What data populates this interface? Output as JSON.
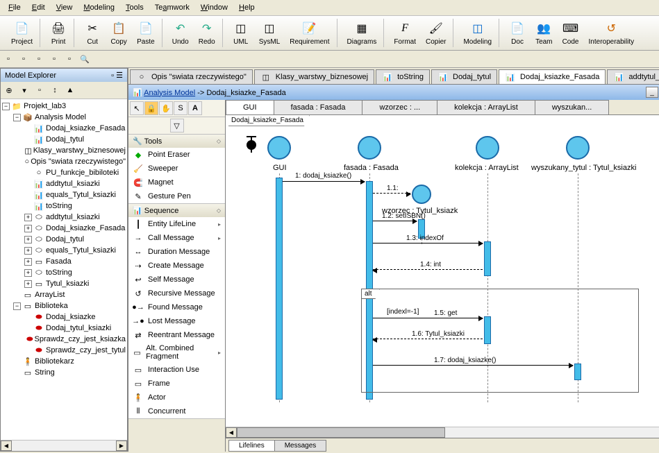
{
  "menu": {
    "file": "File",
    "edit": "Edit",
    "view": "View",
    "modeling": "Modeling",
    "tools": "Tools",
    "teamwork": "Teamwork",
    "window": "Window",
    "help": "Help"
  },
  "toolbar": {
    "project": "Project",
    "print": "Print",
    "cut": "Cut",
    "copy": "Copy",
    "paste": "Paste",
    "undo": "Undo",
    "redo": "Redo",
    "uml": "UML",
    "sysml": "SysML",
    "requirement": "Requirement",
    "diagrams": "Diagrams",
    "format": "Format",
    "copier": "Copier",
    "modeling": "Modeling",
    "doc": "Doc",
    "team": "Team",
    "code": "Code",
    "interoperability": "Interoperability"
  },
  "explorer": {
    "title": "Model Explorer",
    "root": "Projekt_lab3",
    "items": [
      "Analysis Model",
      "Dodaj_ksiazke_Fasada",
      "Dodaj_tytul",
      "Klasy_warstwy_biznesowej",
      "Opis \"swiata rzeczywistego\"",
      "PU_funkcje_bibiloteki",
      "addtytul_ksiazki",
      "equals_Tytul_ksiazki",
      "toString",
      "addtytul_ksiazki",
      "Dodaj_ksiazke_Fasada",
      "Dodaj_tytul",
      "equals_Tytul_ksiazki",
      "Fasada",
      "toString",
      "Tytul_ksiazki",
      "ArrayList",
      "Biblioteka",
      "Dodaj_ksiazke",
      "Dodaj_tytul_ksiazki",
      "Sprawdz_czy_jest_ksiazka",
      "Sprawdz_czy_jest_tytul",
      "Bibliotekarz",
      "String"
    ]
  },
  "doc_tabs": [
    "Opis \"swiata rzeczywistego\"",
    "Klasy_warstwy_biznesowej",
    "toString",
    "Dodaj_tytul",
    "Dodaj_ksiazke_Fasada",
    "addtytul_ksiazki"
  ],
  "diagram": {
    "breadcrumb_model": "Analysis Model",
    "breadcrumb_diag": "Dodaj_ksiazke_Fasada",
    "lifelines": [
      "GUI",
      "fasada : Fasada",
      "wzorzec : ...",
      "kolekcja : ArrayList",
      "wyszukan..."
    ],
    "frame_label": "Dodaj_ksiazke_Fasada",
    "actors": {
      "gui": "GUI",
      "fasada": "fasada : Fasada",
      "wzorzec": "wzorzec : Tytul_ksiazk",
      "kolekcja": "kolekcja : ArrayList",
      "wyszukany": "wyszukany_tytul : Tytul_ksiazki"
    },
    "messages": {
      "m1": "1: dodaj_ksiazke()",
      "m11": "1.1:",
      "m12": "1.2: setISBN()",
      "m13": "1.3: indexOf",
      "m14": "1.4: int",
      "m15": "1.5: get",
      "m16": "1.6: Tytul_ksiazki",
      "m17": "1.7: dodaj_ksiazke()"
    },
    "alt": "alt",
    "guard": "[indexl=-1]"
  },
  "palette": {
    "tools_title": "Tools",
    "tools": [
      "Point Eraser",
      "Sweeper",
      "Magnet",
      "Gesture Pen"
    ],
    "seq_title": "Sequence",
    "seq": [
      "Entity LifeLine",
      "Call Message",
      "Duration Message",
      "Create Message",
      "Self Message",
      "Recursive Message",
      "Found Message",
      "Lost Message",
      "Reentrant Message",
      "Alt. Combined Fragment",
      "Interaction Use",
      "Frame",
      "Actor",
      "Concurrent"
    ]
  },
  "bottom_tabs": {
    "lifelines": "Lifelines",
    "messages": "Messages"
  }
}
